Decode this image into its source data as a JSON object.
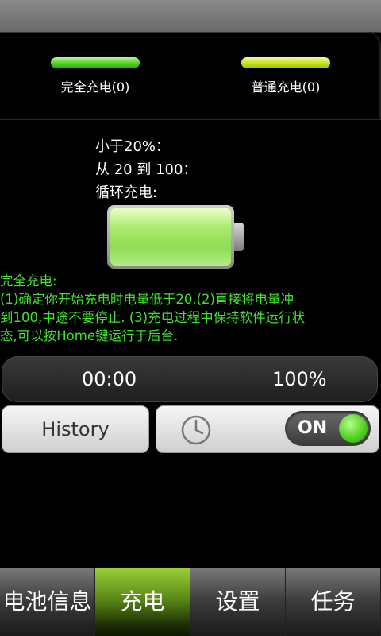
{
  "modes": {
    "full": {
      "label": "完全充电(0)",
      "color": "#4fd421"
    },
    "normal": {
      "label": "普通充电(0)",
      "color": "#c8e21a"
    }
  },
  "info": {
    "line1": "小于20%：",
    "line2": "从 20 到 100：",
    "line3": "循环充电:"
  },
  "description": {
    "title": "完全充电:",
    "line1": "(1)确定你开始充电时电量低于20.(2)直接将电量冲",
    "line2": "到100,中途不要停止. (3)充电过程中保持软件运行状",
    "line3": "态,可以按Home键运行于后台.",
    "color": "#3ee22a"
  },
  "status": {
    "time": "00:00",
    "percent": "100%"
  },
  "controls": {
    "history_label": "History",
    "timer_toggle_label": "ON",
    "timer_icon": "clock-icon"
  },
  "tabs": [
    {
      "label": "电池信息"
    },
    {
      "label": "充电"
    },
    {
      "label": "设置"
    },
    {
      "label": "任务"
    }
  ]
}
